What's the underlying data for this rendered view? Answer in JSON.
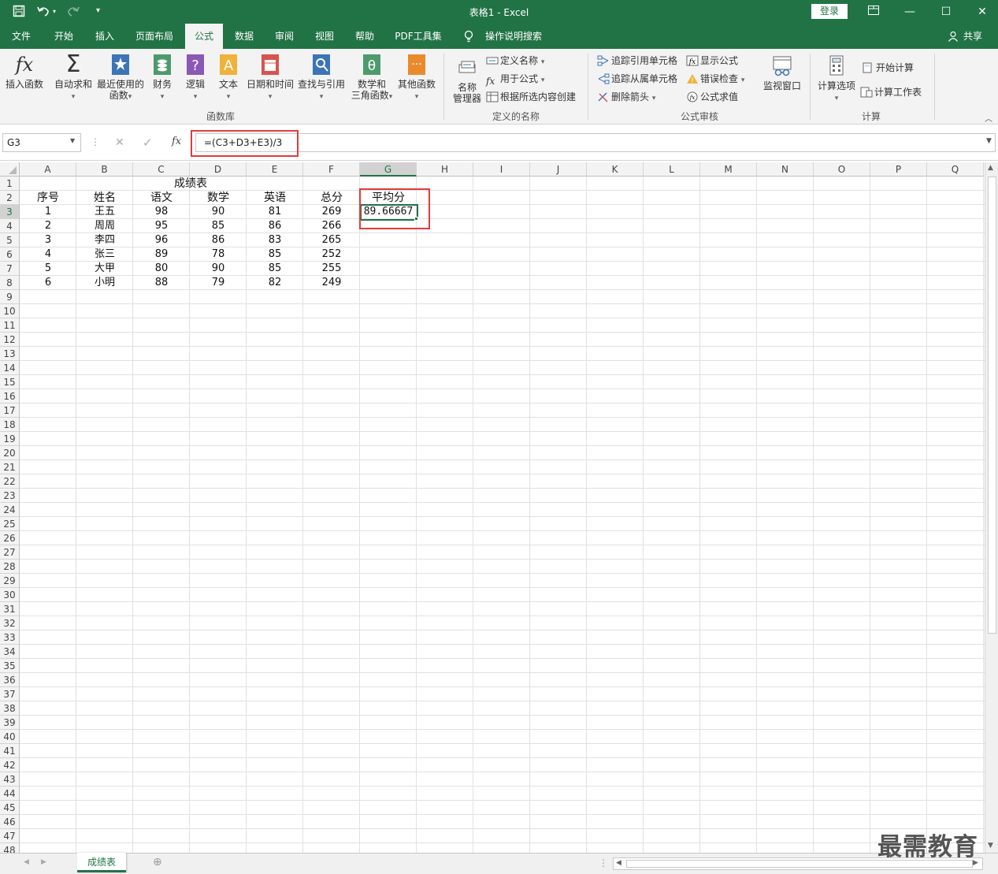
{
  "window": {
    "title": "表格1  -  Excel",
    "login": "登录",
    "share": "共享"
  },
  "tabs": [
    "文件",
    "开始",
    "插入",
    "页面布局",
    "公式",
    "数据",
    "审阅",
    "视图",
    "帮助",
    "PDF工具集",
    "操作说明搜索"
  ],
  "active_tab": "公式",
  "ribbon": {
    "function_library": {
      "group_label": "函数库",
      "insert_function": "插入函数",
      "autosum": "自动求和",
      "recent": [
        "最近使用的",
        "函数"
      ],
      "finance": "财务",
      "logic": "逻辑",
      "text": "文本",
      "datetime": "日期和时间",
      "lookup": "查找与引用",
      "math": [
        "数学和",
        "三角函数"
      ],
      "more": "其他函数"
    },
    "defined_names": {
      "group_label": "定义的名称",
      "name_manager": [
        "名称",
        "管理器"
      ],
      "define_name": "定义名称",
      "use_in_formula": "用于公式",
      "create_from_selection": "根据所选内容创建"
    },
    "formula_auditing": {
      "group_label": "公式审核",
      "trace_precedents": "追踪引用单元格",
      "trace_dependents": "追踪从属单元格",
      "remove_arrows": "删除箭头",
      "show_formulas": "显示公式",
      "error_checking": "错误检查",
      "evaluate_formula": "公式求值",
      "watch_window": "监视窗口"
    },
    "calculation": {
      "group_label": "计算",
      "calc_options": "计算选项",
      "calc_now": "开始计算",
      "calc_sheet": "计算工作表"
    }
  },
  "formula_bar": {
    "name_box": "G3",
    "formula": "=(C3+D3+E3)/3",
    "fx": "fx"
  },
  "grid": {
    "columns": [
      "A",
      "B",
      "C",
      "D",
      "E",
      "F",
      "G",
      "H",
      "I",
      "J",
      "K",
      "L",
      "M",
      "N",
      "O",
      "P",
      "Q"
    ],
    "selected_column": "G",
    "row_count": 48,
    "title_cell": "成绩表",
    "headers": [
      "序号",
      "姓名",
      "语文",
      "数学",
      "英语",
      "总分",
      "平均分"
    ],
    "rows": [
      [
        "1",
        "王五",
        "98",
        "90",
        "81",
        "269",
        "89.66667"
      ],
      [
        "2",
        "周周",
        "95",
        "85",
        "86",
        "266",
        ""
      ],
      [
        "3",
        "李四",
        "96",
        "86",
        "83",
        "265",
        ""
      ],
      [
        "4",
        "张三",
        "89",
        "78",
        "85",
        "252",
        ""
      ],
      [
        "5",
        "大甲",
        "80",
        "90",
        "85",
        "255",
        ""
      ],
      [
        "6",
        "小明",
        "88",
        "79",
        "82",
        "249",
        ""
      ]
    ],
    "active_cell": "G3"
  },
  "sheet_tabs": [
    "成绩表"
  ],
  "watermark": "最需教育",
  "colors": {
    "excel_green": "#217346",
    "highlight_red": "#e23b3b"
  }
}
